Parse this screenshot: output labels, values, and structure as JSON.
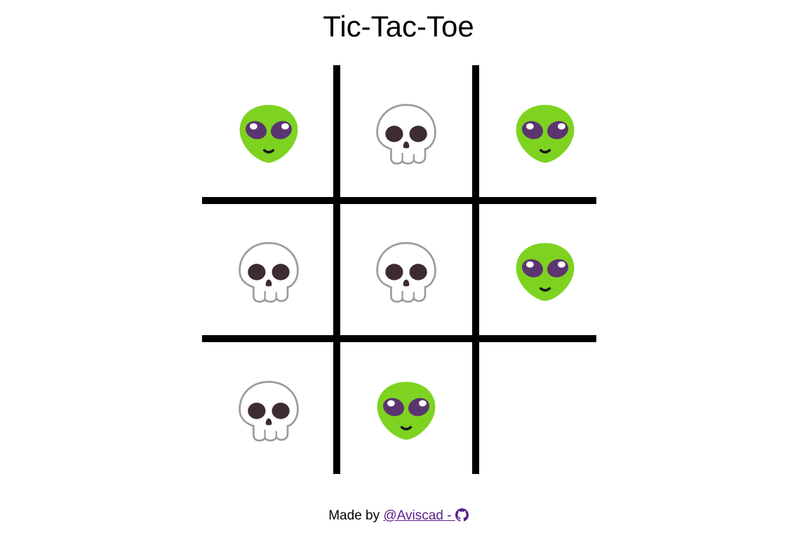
{
  "title": "Tic-Tac-Toe",
  "board": {
    "cells": [
      "alien",
      "skull",
      "alien",
      "skull",
      "skull",
      "alien",
      "skull",
      "alien",
      ""
    ]
  },
  "pieces": {
    "alien": "alien-icon",
    "skull": "skull-icon"
  },
  "footer": {
    "made_by": "Made by",
    "link_text": "@Aviscad -",
    "icon": "github-icon"
  },
  "colors": {
    "alien_green": "#7ed321",
    "alien_eye": "#5b3570",
    "skull_outline": "#9b9b9b",
    "skull_eye": "#3d2b33",
    "link": "#5a1f8a"
  }
}
